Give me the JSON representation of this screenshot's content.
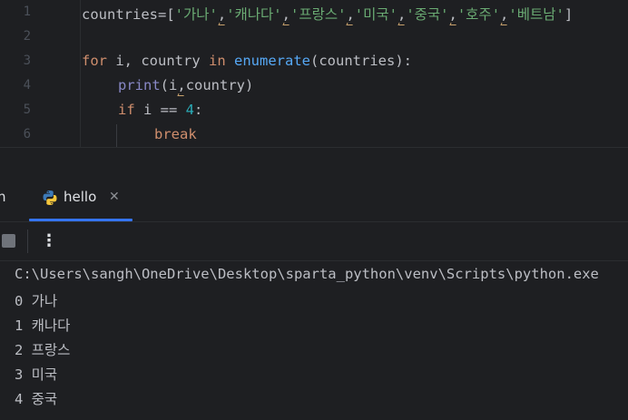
{
  "editor": {
    "line_numbers": [
      "1",
      "2",
      "3",
      "4",
      "5",
      "6"
    ],
    "line1": {
      "prefix": "countries=[",
      "items": [
        "'가나'",
        "'캐나다'",
        "'프랑스'",
        "'미국'",
        "'중국'",
        "'호주'",
        "'베트남'"
      ],
      "sep": ",",
      "suffix": "]"
    },
    "line3": {
      "kw_for": "for",
      "vars": " i, country ",
      "kw_in": "in",
      "space": " ",
      "fn": "enumerate",
      "args": "(countries):"
    },
    "line4": {
      "fn": "print",
      "open": "(i",
      "sep": ",",
      "close": "country)"
    },
    "line5": {
      "kw_if": "if",
      "expr": " i == ",
      "num": "4",
      "colon": ":"
    },
    "line6": {
      "kw_break": "break"
    }
  },
  "run_panel": {
    "cut_tab_label": "n",
    "tab_label": "hello",
    "close_glyph": "✕",
    "more_glyph": "⋮"
  },
  "console": {
    "lines": [
      "C:\\Users\\sangh\\OneDrive\\Desktop\\sparta_python\\venv\\Scripts\\python.exe",
      "0 가나",
      "1 캐나다",
      "2 프랑스",
      "3 미국",
      "4 중국"
    ]
  },
  "colors": {
    "background": "#1e1f22",
    "keyword": "#cf8e6d",
    "string": "#6aab73",
    "function": "#56a8f5",
    "number": "#2aacb8",
    "tab_accent": "#3574f0"
  }
}
